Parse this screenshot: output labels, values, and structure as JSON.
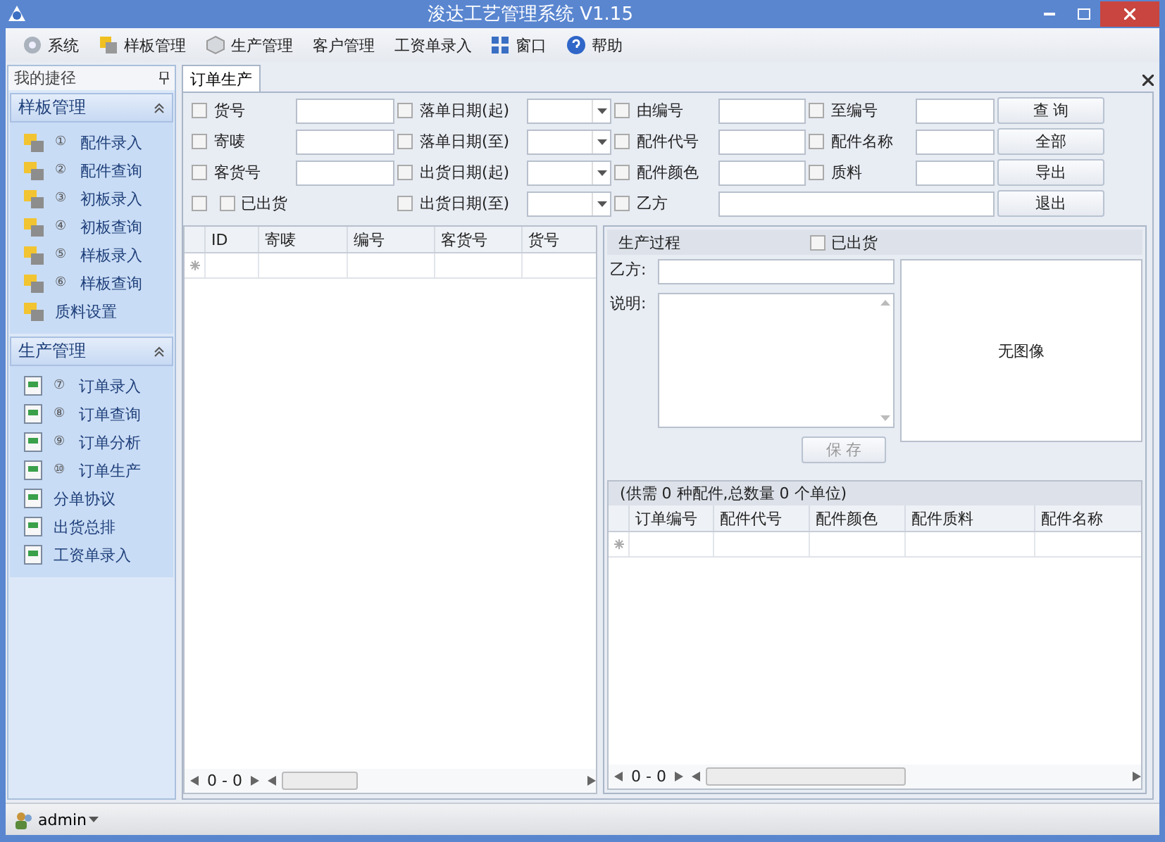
{
  "window": {
    "title": "浚达工艺管理系统 V1.15"
  },
  "menu": [
    {
      "label": "系统"
    },
    {
      "label": "样板管理"
    },
    {
      "label": "生产管理"
    },
    {
      "label": "客户管理"
    },
    {
      "label": "工资单录入"
    },
    {
      "label": "窗口"
    },
    {
      "label": "帮助"
    }
  ],
  "sidebar": {
    "title": "我的捷径",
    "groups": [
      {
        "title": "样板管理",
        "expanded": true,
        "items": [
          {
            "number": "①",
            "label": "配件录入"
          },
          {
            "number": "②",
            "label": "配件查询"
          },
          {
            "number": "③",
            "label": "初板录入"
          },
          {
            "number": "④",
            "label": "初板查询"
          },
          {
            "number": "⑤",
            "label": "样板录入"
          },
          {
            "number": "⑥",
            "label": "样板查询"
          },
          {
            "label": "质料设置"
          }
        ]
      },
      {
        "title": "生产管理",
        "expanded": true,
        "items": [
          {
            "number": "⑦",
            "label": "订单录入"
          },
          {
            "number": "⑧",
            "label": "订单查询"
          },
          {
            "number": "⑨",
            "label": "订单分析"
          },
          {
            "number": "⑩",
            "label": "订单生产"
          },
          {
            "label": "分单协议"
          },
          {
            "label": "出货总排"
          },
          {
            "label": "工资单录入"
          }
        ]
      }
    ]
  },
  "tabs": [
    {
      "label": "订单生产",
      "selected": true
    }
  ],
  "filters": [
    {
      "fields": [
        {
          "kind": "text",
          "label": "货号",
          "checked": false
        },
        {
          "kind": "date",
          "label": "落单日期(起)",
          "checked": false
        },
        {
          "kind": "text",
          "label": "由编号",
          "checked": false
        },
        {
          "kind": "text",
          "label": "至编号",
          "checked": false
        }
      ],
      "button": "查 询"
    },
    {
      "fields": [
        {
          "kind": "text",
          "label": "寄唛",
          "checked": false
        },
        {
          "kind": "date",
          "label": "落单日期(至)",
          "checked": false
        },
        {
          "kind": "text",
          "label": "配件代号",
          "checked": false
        },
        {
          "kind": "text",
          "label": "配件名称",
          "checked": false
        }
      ],
      "button": "全部"
    },
    {
      "fields": [
        {
          "kind": "text",
          "label": "客货号",
          "checked": false
        },
        {
          "kind": "date",
          "label": "出货日期(起)",
          "checked": false
        },
        {
          "kind": "text",
          "label": "配件颜色",
          "checked": false
        },
        {
          "kind": "text",
          "label": "质料",
          "checked": false
        }
      ],
      "button": "导出"
    },
    {
      "fields": [
        {
          "kind": "flag",
          "label": "已出货",
          "checked": false,
          "flag_checked": false
        },
        {
          "kind": "date",
          "label": "出货日期(至)",
          "checked": false
        },
        {
          "kind": "wide",
          "label": "乙方",
          "checked": false
        }
      ],
      "button": "退出"
    }
  ],
  "orders_grid": {
    "columns": [
      "ID",
      "寄唛",
      "编号",
      "客货号",
      "货号"
    ],
    "pager": "0 - 0"
  },
  "process": {
    "title": "生产过程",
    "shipped": {
      "label": "已出货",
      "checked": false
    },
    "party_label": "乙方:",
    "note_label": "说明:",
    "image_text": "无图像",
    "save": {
      "label": "保 存",
      "disabled": true
    }
  },
  "parts": {
    "summary": "(供需 0 种配件,总数量 0 个单位)",
    "columns": [
      "订单编号",
      "配件代号",
      "配件颜色",
      "配件质料",
      "配件名称"
    ],
    "pager": "0 - 0"
  },
  "status_bar": {
    "user": "admin"
  }
}
